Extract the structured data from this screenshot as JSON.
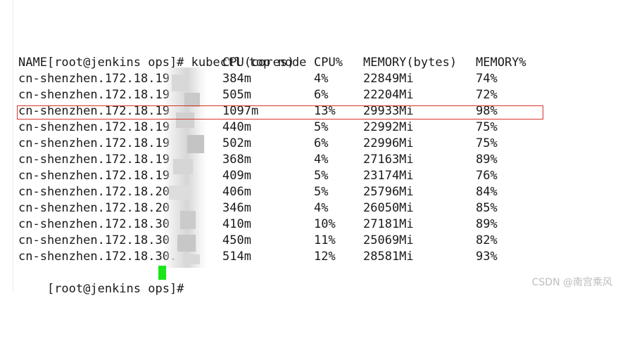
{
  "command_line": "[root@jenkins ops]# kubectl top node",
  "table": {
    "headers": [
      "NAME",
      "CPU(cores)",
      "CPU%",
      "MEMORY(bytes)",
      "MEMORY%"
    ],
    "rows": [
      {
        "name": "cn-shenzhen.172.18.19",
        "cpu": "384m",
        "cpu_pct": "4%",
        "mem": "22849Mi",
        "mem_pct": "74%"
      },
      {
        "name": "cn-shenzhen.172.18.19",
        "cpu": "505m",
        "cpu_pct": "6%",
        "mem": "22204Mi",
        "mem_pct": "72%"
      },
      {
        "name": "cn-shenzhen.172.18.19",
        "cpu": "1097m",
        "cpu_pct": "13%",
        "mem": "29933Mi",
        "mem_pct": "98%"
      },
      {
        "name": "cn-shenzhen.172.18.19",
        "cpu": "440m",
        "cpu_pct": "5%",
        "mem": "22992Mi",
        "mem_pct": "75%"
      },
      {
        "name": "cn-shenzhen.172.18.19",
        "cpu": "502m",
        "cpu_pct": "6%",
        "mem": "22996Mi",
        "mem_pct": "75%"
      },
      {
        "name": "cn-shenzhen.172.18.19",
        "cpu": "368m",
        "cpu_pct": "4%",
        "mem": "27163Mi",
        "mem_pct": "89%"
      },
      {
        "name": "cn-shenzhen.172.18.19",
        "cpu": "409m",
        "cpu_pct": "5%",
        "mem": "23174Mi",
        "mem_pct": "76%"
      },
      {
        "name": "cn-shenzhen.172.18.20",
        "cpu": "406m",
        "cpu_pct": "5%",
        "mem": "25796Mi",
        "mem_pct": "84%"
      },
      {
        "name": "cn-shenzhen.172.18.20",
        "cpu": "346m",
        "cpu_pct": "4%",
        "mem": "26050Mi",
        "mem_pct": "85%"
      },
      {
        "name": "cn-shenzhen.172.18.30",
        "cpu": "410m",
        "cpu_pct": "10%",
        "mem": "27181Mi",
        "mem_pct": "89%"
      },
      {
        "name": "cn-shenzhen.172.18.30",
        "cpu": "450m",
        "cpu_pct": "11%",
        "mem": "25069Mi",
        "mem_pct": "82%"
      },
      {
        "name": "cn-shenzhen.172.18.30.",
        "cpu": "514m",
        "cpu_pct": "12%",
        "mem": "28581Mi",
        "mem_pct": "93%"
      }
    ]
  },
  "prompt_line": "[root@jenkins ops]#",
  "highlighted_row_index": 2,
  "colors": {
    "text": "#1a1a1a",
    "highlight_border": "#d9332b",
    "cursor": "#19e619",
    "watermark": "#bdbdbd"
  },
  "watermark": "CSDN @南宫乘风"
}
